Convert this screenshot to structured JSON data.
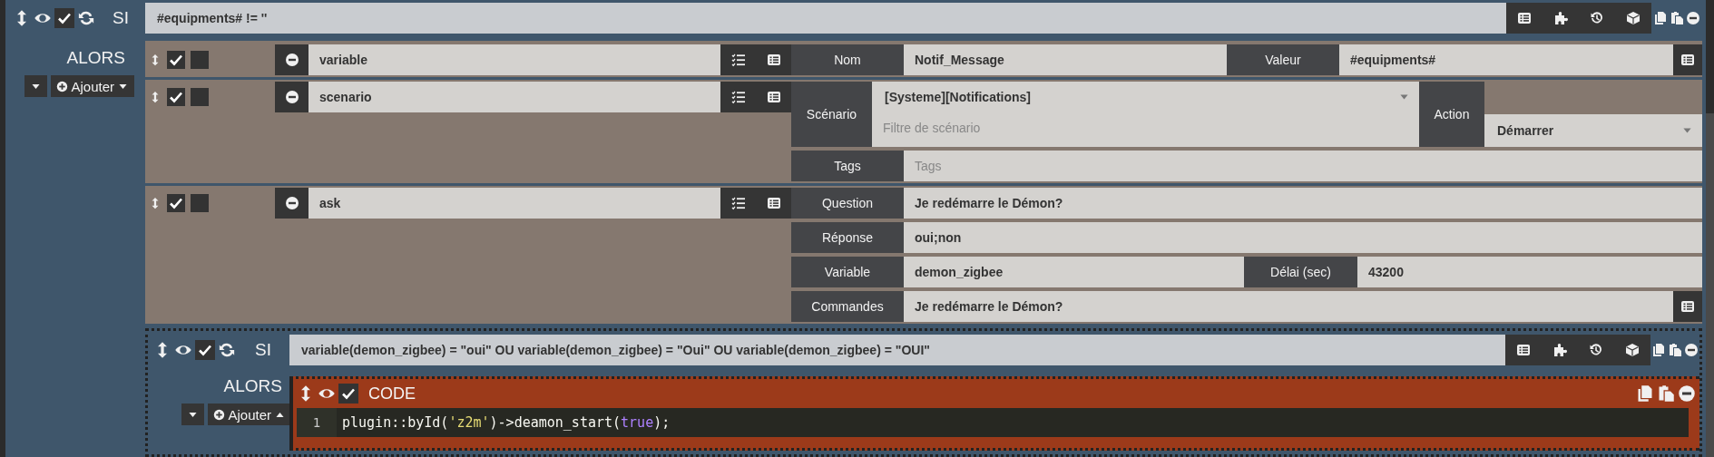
{
  "if_block": {
    "keyword": "SI",
    "enabled": true,
    "condition": "#equipments# != ''",
    "then_keyword": "ALORS",
    "add_label": "Ajouter",
    "add_expanded": false,
    "actions": [
      {
        "kind": "variable",
        "type": "variable",
        "enabled": true,
        "parallel": false,
        "name_label": "Nom",
        "name": "Notif_Message",
        "value_label": "Valeur",
        "value": "#equipments#"
      },
      {
        "kind": "scenario",
        "type": "scenario",
        "enabled": true,
        "parallel": false,
        "scenario_label": "Scénario",
        "scenario": "[Systeme][Notifications]",
        "filter_placeholder": "Filtre de scénario",
        "action_label": "Action",
        "action": "Démarrer",
        "tags_label": "Tags",
        "tags_placeholder": "Tags"
      },
      {
        "kind": "ask",
        "type": "ask",
        "enabled": true,
        "parallel": false,
        "question_label": "Question",
        "question": "Je redémarre le Démon?",
        "response_label": "Réponse",
        "response": "oui;non",
        "variable_label": "Variable",
        "variable": "demon_zigbee",
        "delay_label": "Délai (sec)",
        "delay": "43200",
        "commands_label": "Commandes",
        "commands": "Je redémarre le Démon?"
      }
    ],
    "nested_if": {
      "keyword": "SI",
      "enabled": true,
      "condition": "variable(demon_zigbee) = \"oui\" OU variable(demon_zigbee) = \"Oui\" OU variable(demon_zigbee) = \"OUI\"",
      "then_keyword": "ALORS",
      "add_label": "Ajouter",
      "add_expanded": true,
      "code_block": {
        "title": "CODE",
        "enabled": true,
        "lines": [
          {
            "number": "1",
            "tokens": [
              {
                "kind": "plain",
                "text": "plugin::byId("
              },
              {
                "kind": "string",
                "text": "'z2m'"
              },
              {
                "kind": "plain",
                "text": ")->deamon_start("
              },
              {
                "kind": "keyword",
                "text": "true"
              },
              {
                "kind": "plain",
                "text": ");"
              }
            ]
          }
        ]
      }
    }
  }
}
